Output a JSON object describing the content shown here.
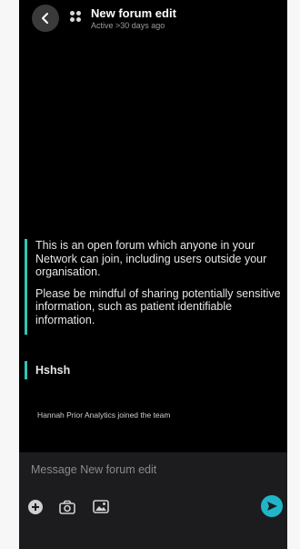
{
  "header": {
    "back_icon": "chevron-left-icon",
    "group_icon": "group-icon",
    "title": "New forum edit",
    "status": "Active >30 days ago"
  },
  "notice": {
    "line1": "This is an open forum which anyone in your Network can join, including users outside your organisation.",
    "line2": "Please be mindful of sharing potentially sensitive information, such as patient identifiable information."
  },
  "messages": [
    {
      "text": "Hshsh"
    }
  ],
  "system_message": "Hannah Prior Analytics joined the team",
  "composer": {
    "placeholder": "Message New forum edit",
    "icons": [
      "plus-icon",
      "camera-icon",
      "image-icon",
      "send-icon"
    ]
  },
  "colors": {
    "accent": "#2ec4b6",
    "send": "#20b6c8",
    "background": "#000000",
    "composer_bg": "#1c1c1e"
  }
}
